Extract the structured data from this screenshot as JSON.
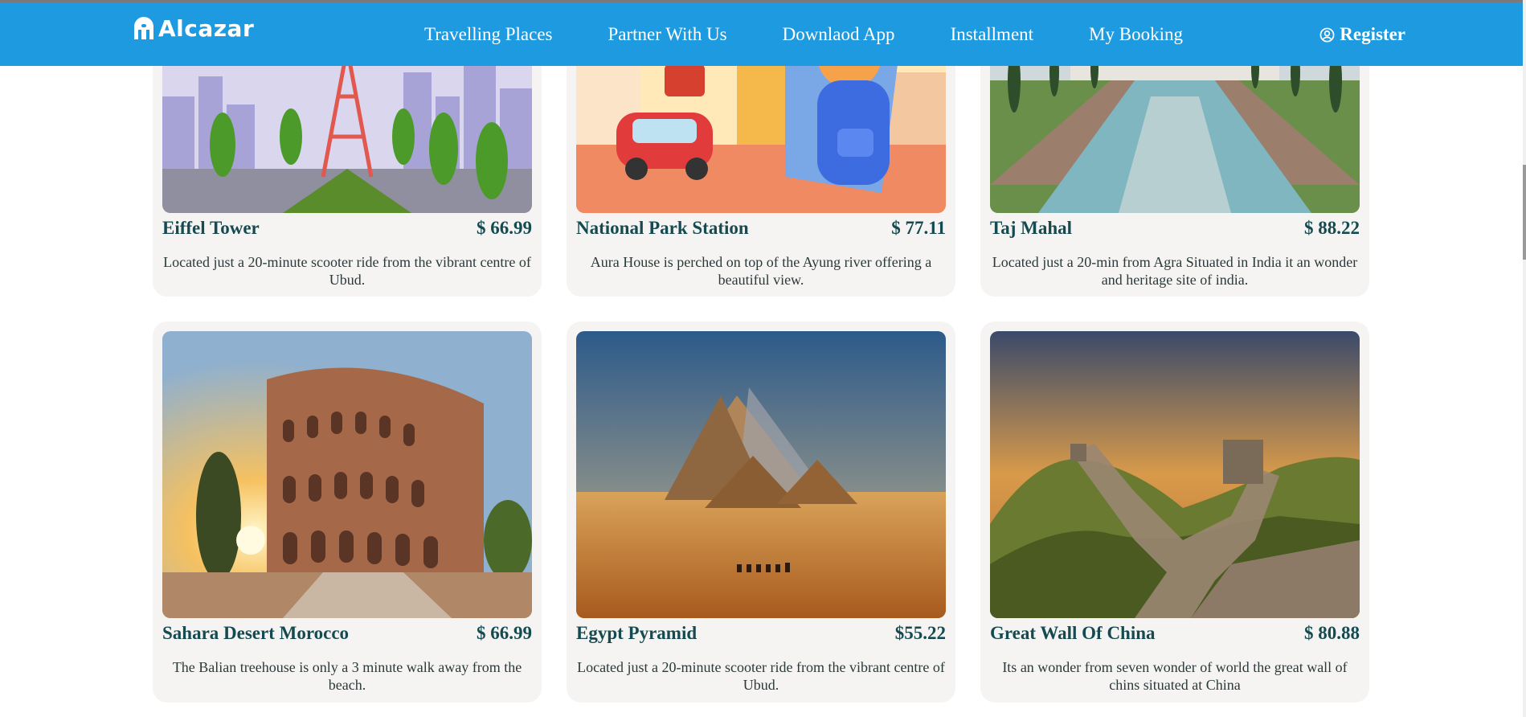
{
  "brand": {
    "name": "Alcazar",
    "color": "#1e9be0"
  },
  "nav": {
    "links": [
      "Travelling Places",
      "Partner With Us",
      "Downlaod App",
      "Installment",
      "My Booking"
    ],
    "register": "Register"
  },
  "cards": [
    {
      "title": "Eiffel Tower",
      "price": "$ 66.99",
      "desc": "Located just a 20-minute scooter ride from the vibrant centre of Ubud."
    },
    {
      "title": "National Park Station",
      "price": "$ 77.11",
      "desc": "Aura House is perched on top of the Ayung river offering a beautiful view."
    },
    {
      "title": "Taj Mahal",
      "price": "$ 88.22",
      "desc": "Located just a 20-min from Agra Situated in India it an wonder and heritage site of india."
    },
    {
      "title": "Sahara Desert Morocco",
      "price": "$ 66.99",
      "desc": "The Balian treehouse is only a 3 minute walk away from the beach."
    },
    {
      "title": "Egypt Pyramid",
      "price": "$55.22",
      "desc": "Located just a 20-minute scooter ride from the vibrant centre of Ubud."
    },
    {
      "title": "Great Wall Of China",
      "price": "$ 80.88",
      "desc": "Its an wonder from seven wonder of world the great wall of chins situated at China"
    }
  ]
}
